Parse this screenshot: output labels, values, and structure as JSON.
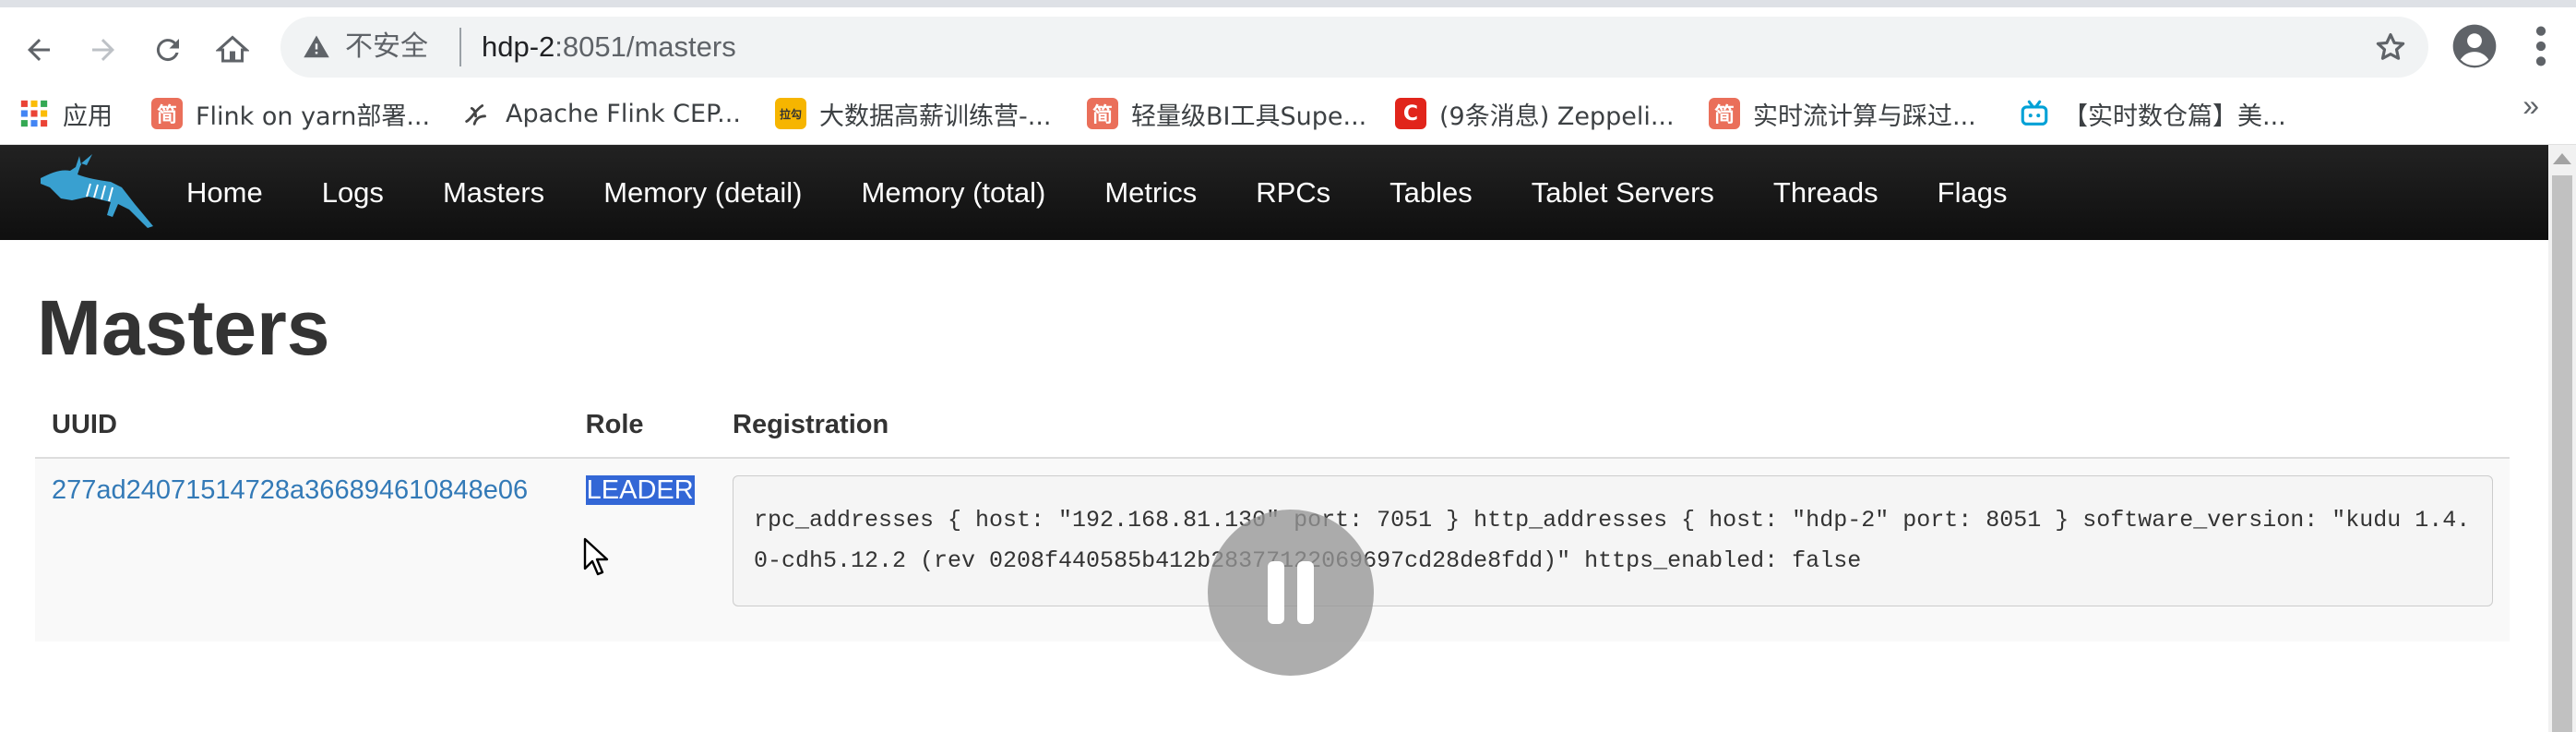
{
  "browser": {
    "url_security_label": "不安全",
    "url_host": "hdp-2",
    "url_rest": ":8051/masters",
    "icons": [
      "back-icon",
      "forward-icon",
      "reload-icon",
      "home-icon",
      "warning-icon",
      "star-icon",
      "profile-icon",
      "menu-icon"
    ]
  },
  "bookmarks": {
    "items": [
      {
        "label": "应用",
        "icon": "apps-grid-icon"
      },
      {
        "label": "Flink on yarn部署...",
        "icon": "jianshu-icon"
      },
      {
        "label": "Apache Flink CEP...",
        "icon": "flink-icon"
      },
      {
        "label": "大数据高薪训练营-...",
        "icon": "lagou-icon"
      },
      {
        "label": "轻量级BI工具Supe...",
        "icon": "jianshu-icon"
      },
      {
        "label": "(9条消息) Zeppeli...",
        "icon": "csdn-icon"
      },
      {
        "label": "实时流计算与踩过...",
        "icon": "jianshu-icon"
      },
      {
        "label": "【实时数仓篇】美...",
        "icon": "bilibili-icon"
      }
    ],
    "more": "»"
  },
  "navbar": {
    "brand_icon": "kudu-logo",
    "links": [
      "Home",
      "Logs",
      "Masters",
      "Memory (detail)",
      "Memory (total)",
      "Metrics",
      "RPCs",
      "Tables",
      "Tablet Servers",
      "Threads",
      "Flags"
    ]
  },
  "page": {
    "title": "Masters",
    "table": {
      "headers": [
        "UUID",
        "Role",
        "Registration"
      ],
      "rows": [
        {
          "uuid": "277ad24071514728a366894610848e06",
          "role": "LEADER",
          "registration": "rpc_addresses { host: \"192.168.81.130\" port: 7051 } http_addresses { host: \"hdp-2\" port: 8051 } software_version: \"kudu 1.4.0-cdh5.12.2 (rev 0208f440585b412b28377122069697cd28de8fdd)\" https_enabled: false"
        }
      ]
    }
  },
  "overlay": {
    "icon": "pause-icon"
  },
  "colors": {
    "navbar": "#1a1a1a",
    "link": "#337ab7",
    "selection": "#3367d6"
  }
}
